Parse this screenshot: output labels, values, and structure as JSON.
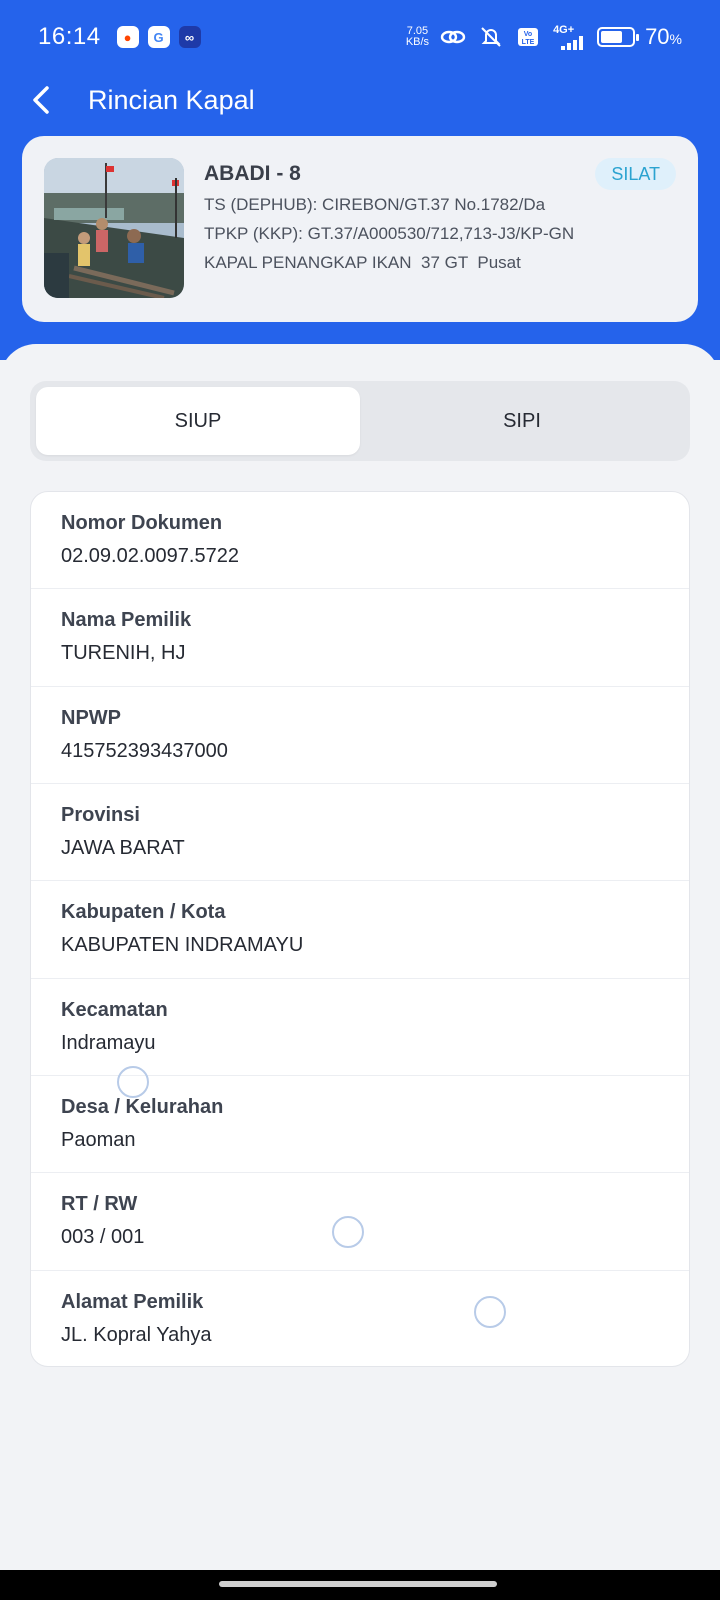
{
  "status_bar": {
    "time": "16:14",
    "net_speed_value": "7.05",
    "net_speed_unit": "KB/s",
    "network": "4G+",
    "battery_percent": "70",
    "battery_symbol": "%",
    "battery_level": 0.7
  },
  "app_bar": {
    "title": "Rincian Kapal"
  },
  "vessel": {
    "name": "ABADI - 8",
    "badge": "SILAT",
    "ts_line": "TS (DEPHUB): CIREBON/GT.37 No.1782/Da",
    "tpkp_line": "TPKP (KKP): GT.37/A000530/712,713-J3/KP-GN",
    "type_line": "KAPAL PENANGKAP IKAN  37 GT  Pusat"
  },
  "tabs": [
    {
      "label": "SIUP",
      "active": true
    },
    {
      "label": "SIPI",
      "active": false
    }
  ],
  "details": [
    {
      "label": "Nomor Dokumen",
      "value": "02.09.02.0097.5722"
    },
    {
      "label": "Nama Pemilik",
      "value": "TURENIH, HJ"
    },
    {
      "label": "NPWP",
      "value": "415752393437000"
    },
    {
      "label": "Provinsi",
      "value": "JAWA BARAT"
    },
    {
      "label": "Kabupaten / Kota",
      "value": "KABUPATEN INDRAMAYU"
    },
    {
      "label": "Kecamatan",
      "value": "Indramayu"
    },
    {
      "label": "Desa / Kelurahan",
      "value": "Paoman"
    },
    {
      "label": "RT / RW",
      "value": "003 / 001"
    },
    {
      "label": "Alamat Pemilik",
      "value": "JL. Kopral Yahya"
    }
  ],
  "colors": {
    "primary": "#2563eb",
    "badge_bg": "#dff0fb",
    "badge_text": "#2ba3d0",
    "background": "#f2f3f6"
  }
}
